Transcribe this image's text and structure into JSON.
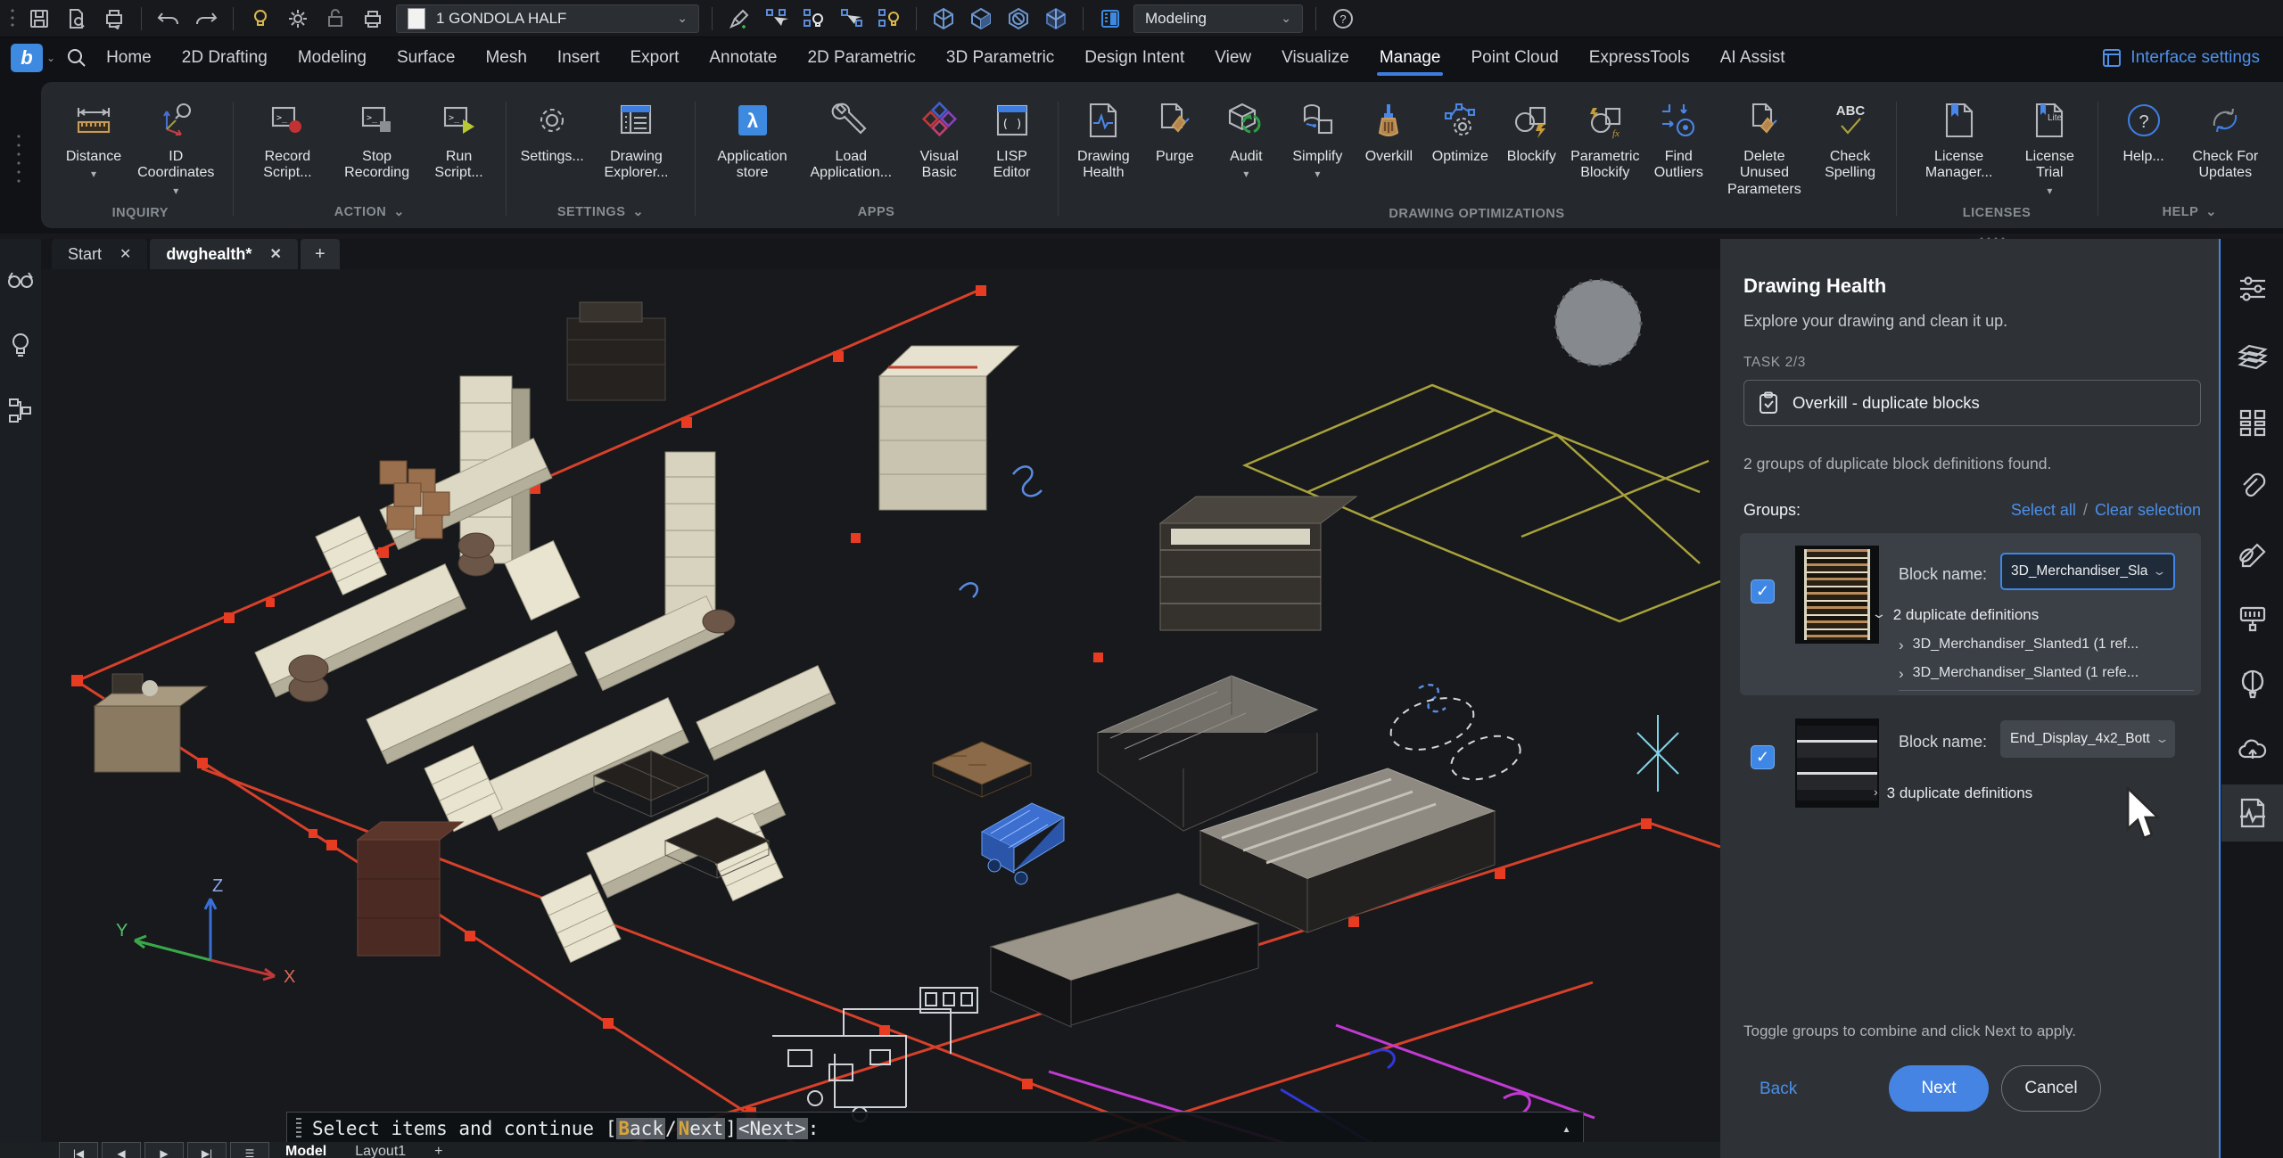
{
  "colors": {
    "accent": "#3d7de5",
    "panel_bg": "#2e3237",
    "canvas_bg": "#17191c",
    "primary_button": "#4584e3",
    "command_token_bg": "#5a5f66",
    "command_initial": "#d7a43c"
  },
  "icons": {
    "dropdown": "▾",
    "chevron_down": "⌄",
    "caret_right": "›",
    "close": "✕",
    "plus": "+",
    "help": "?",
    "check": "✓",
    "expand_up": "▴",
    "nav_first": "|◀",
    "nav_prev": "◀",
    "nav_next": "▶",
    "nav_last": "▶|",
    "list": "☰",
    "terminal_prompt": ">_",
    "lisp_parens": "( )",
    "abc_label": "ABC",
    "lite_label": "Lite",
    "app_logo": "λ",
    "logo_letter": "b"
  },
  "qat": {
    "layer_value": "1 GONDOLA HALF",
    "workspace_value": "Modeling"
  },
  "menu": {
    "tabs": [
      {
        "label": "Home"
      },
      {
        "label": "2D Drafting"
      },
      {
        "label": "Modeling"
      },
      {
        "label": "Surface"
      },
      {
        "label": "Mesh"
      },
      {
        "label": "Insert"
      },
      {
        "label": "Export"
      },
      {
        "label": "Annotate"
      },
      {
        "label": "2D Parametric"
      },
      {
        "label": "3D Parametric"
      },
      {
        "label": "Design Intent"
      },
      {
        "label": "View"
      },
      {
        "label": "Visualize"
      },
      {
        "label": "Manage"
      },
      {
        "label": "Point Cloud"
      },
      {
        "label": "ExpressTools"
      },
      {
        "label": "AI Assist"
      }
    ],
    "active_tab": "Manage",
    "interface_settings": "Interface settings"
  },
  "ribbon": {
    "groups": [
      {
        "label": "INQUIRY",
        "buttons": [
          {
            "label": "Distance"
          },
          {
            "label": "ID Coordinates"
          }
        ]
      },
      {
        "label": "ACTION",
        "buttons": [
          {
            "label": "Record Script..."
          },
          {
            "label": "Stop Recording"
          },
          {
            "label": "Run Script..."
          }
        ]
      },
      {
        "label": "SETTINGS",
        "buttons": [
          {
            "label": "Settings..."
          },
          {
            "label": "Drawing Explorer..."
          }
        ]
      },
      {
        "label": "APPS",
        "buttons": [
          {
            "label": "Application store"
          },
          {
            "label": "Load Application..."
          },
          {
            "label": "Visual Basic"
          },
          {
            "label": "LISP Editor"
          }
        ]
      },
      {
        "label": "DRAWING OPTIMIZATIONS",
        "buttons": [
          {
            "label": "Drawing Health"
          },
          {
            "label": "Purge"
          },
          {
            "label": "Audit"
          },
          {
            "label": "Simplify"
          },
          {
            "label": "Overkill"
          },
          {
            "label": "Optimize"
          },
          {
            "label": "Blockify"
          },
          {
            "label": "Parametric Blockify"
          },
          {
            "label": "Find Outliers"
          },
          {
            "label": "Delete Unused Parameters"
          },
          {
            "label": "Check Spelling"
          }
        ]
      },
      {
        "label": "LICENSES",
        "buttons": [
          {
            "label": "License Manager..."
          },
          {
            "label": "License Trial"
          }
        ]
      },
      {
        "label": "HELP",
        "buttons": [
          {
            "label": "Help..."
          },
          {
            "label": "Check For Updates"
          }
        ]
      }
    ]
  },
  "doc_tabs": {
    "tabs": [
      {
        "label": "Start"
      },
      {
        "label": "dwghealth*"
      }
    ],
    "add": "+"
  },
  "panel": {
    "title": "Drawing Health",
    "subtitle": "Explore your drawing and clean it up.",
    "task_label": "TASK 2/3",
    "task_card": "Overkill - duplicate blocks",
    "result_text": "2 groups of duplicate block definitions found.",
    "groups_label": "Groups:",
    "select_all": "Select all",
    "link_separator": "/",
    "clear_selection": "Clear selection",
    "groups": [
      {
        "block_name_label": "Block name:",
        "block_name": "3D_Merchandiser_Sla",
        "summary": "2 duplicate definitions",
        "children": [
          "3D_Merchandiser_Slanted1 (1 ref...",
          "3D_Merchandiser_Slanted (1 refe..."
        ]
      },
      {
        "block_name_label": "Block name:",
        "block_name": "End_Display_4x2_Bott",
        "summary": "3 duplicate definitions"
      }
    ],
    "footer_hint": "Toggle groups to combine and click Next to apply.",
    "back": "Back",
    "next": "Next",
    "cancel": "Cancel"
  },
  "command": {
    "prompt_prefix": "Select items and continue [",
    "option1_initial": "B",
    "option1_rest": "ack",
    "option_divider": "/",
    "option2_initial": "N",
    "option2_rest": "ext",
    "suffix_mid": "] ",
    "default_option": "<Next>",
    "suffix_end": ":"
  },
  "statusbar": {
    "model": "Model",
    "layout": "Layout1",
    "add_layout": "+"
  },
  "canvas": {
    "ucs_x": "X",
    "ucs_y": "Y",
    "ucs_z": "Z"
  }
}
